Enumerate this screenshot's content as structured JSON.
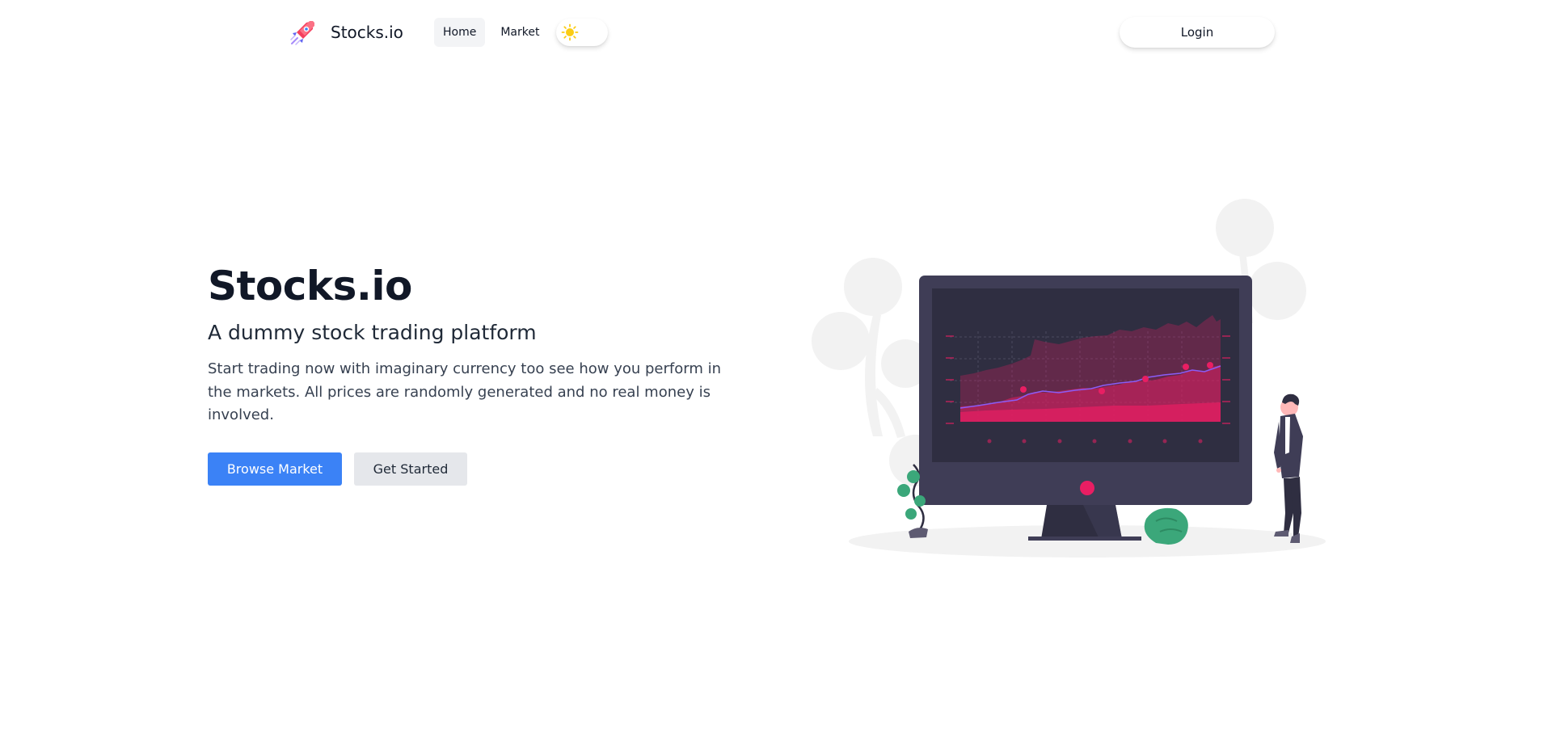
{
  "nav": {
    "brand": "Stocks.io",
    "logo_icon": "rocket-icon",
    "links": [
      {
        "label": "Home",
        "active": true
      },
      {
        "label": "Market",
        "active": false
      }
    ],
    "theme_toggle_icon": "sun-icon",
    "login_label": "Login"
  },
  "hero": {
    "title": "Stocks.io",
    "subtitle": "A dummy stock trading platform",
    "description": "Start trading now with imaginary currency too see how you perform in the markets. All prices are randomly generated and no real money is involved.",
    "primary_button": "Browse Market",
    "secondary_button": "Get Started"
  },
  "colors": {
    "primary": "#3b82f6",
    "secondary_bg": "#e5e7eb",
    "chart_accent": "#e91e63",
    "monitor": "#3f3d56",
    "plant": "#3ba77a"
  }
}
